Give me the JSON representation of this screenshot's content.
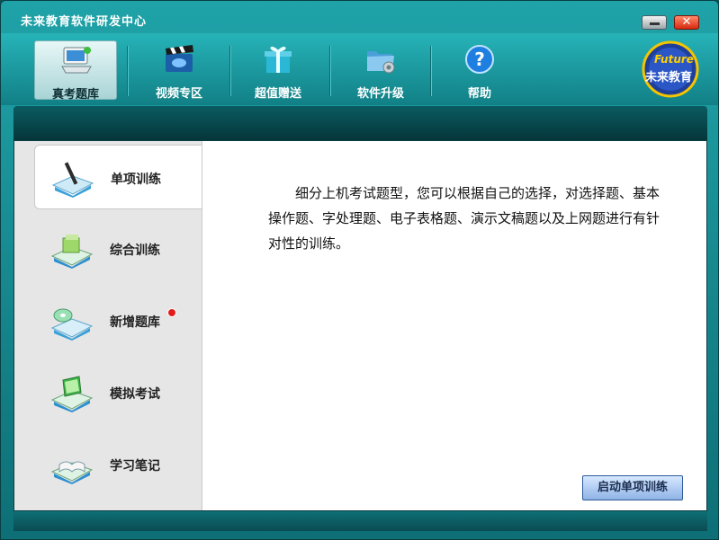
{
  "window": {
    "title": "未来教育软件研发中心",
    "close_label": "✕"
  },
  "toolbar": {
    "items": [
      {
        "label": "真考题库",
        "icon": "computer-icon",
        "active": true
      },
      {
        "label": "视频专区",
        "icon": "clapperboard-icon",
        "active": false
      },
      {
        "label": "超值赠送",
        "icon": "gift-icon",
        "active": false
      },
      {
        "label": "软件升级",
        "icon": "folder-gear-icon",
        "active": false
      },
      {
        "label": "帮助",
        "icon": "help-icon",
        "active": false
      }
    ]
  },
  "logo": {
    "text_en": "Future",
    "text_cn": "未来教育"
  },
  "sidebar": {
    "items": [
      {
        "label": "单项训练",
        "icon": "pen-book-icon",
        "active": true
      },
      {
        "label": "综合训练",
        "icon": "books-icon",
        "active": false
      },
      {
        "label": "新增题库",
        "icon": "cd-disc-icon",
        "active": false,
        "new_badge": true
      },
      {
        "label": "模拟考试",
        "icon": "laptop-icon",
        "active": false
      },
      {
        "label": "学习笔记",
        "icon": "open-book-icon",
        "active": false
      }
    ]
  },
  "main": {
    "description": "细分上机考试题型，您可以根据自己的选择，对选择题、基本操作题、字处理题、电子表格题、演示文稿题以及上网题进行有针对性的训练。",
    "start_button": "启动单项训练"
  },
  "colors": {
    "teal": "#1fa3a8",
    "dark_teal": "#05363a",
    "panel_gray": "#e6e6e6"
  }
}
